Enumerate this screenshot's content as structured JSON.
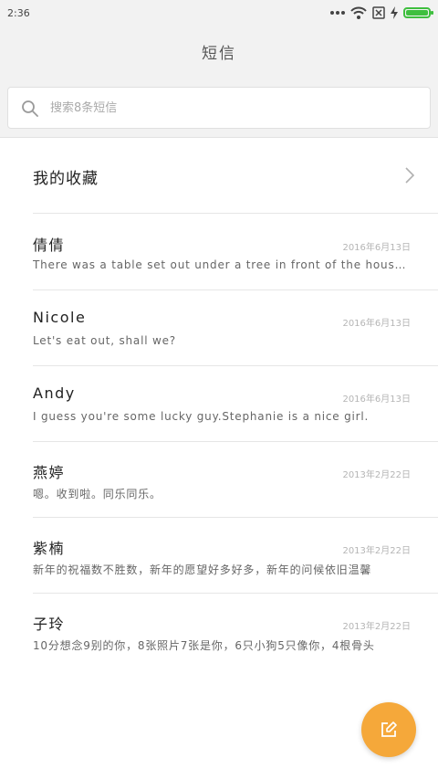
{
  "status_bar": {
    "time": "2:36",
    "icons": [
      "more-dots-icon",
      "wifi-icon",
      "no-sim-icon",
      "charging-icon",
      "battery-icon"
    ],
    "battery_level": 1.0,
    "battery_color": "#3fbf3f"
  },
  "header": {
    "title": "短信"
  },
  "search": {
    "placeholder": "搜索8条短信",
    "value": ""
  },
  "favorites": {
    "label": "我的收藏"
  },
  "conversations": [
    {
      "name": "倩倩",
      "date": "2016年6月13日",
      "snippet": "There was a table set out under a tree in front of the house, and the March Hare and the Hatter were having tea at it"
    },
    {
      "name": "Nicole",
      "date": "2016年6月13日",
      "snippet": "Let's eat out, shall we?"
    },
    {
      "name": "Andy",
      "date": "2016年6月13日",
      "snippet": "I guess you're some lucky guy.Stephanie is a nice girl."
    },
    {
      "name": "燕婷",
      "date": "2013年2月22日",
      "snippet": "嗯。收到啦。同乐同乐。"
    },
    {
      "name": "紫楠",
      "date": "2013年2月22日",
      "snippet": "新年的祝福数不胜数，新年的愿望好多好多，新年的问候依旧温馨"
    },
    {
      "name": "子玲",
      "date": "2013年2月22日",
      "snippet": "10分想念9别的你，8张照片7张是你，6只小狗5只像你，4根骨头"
    }
  ],
  "fab": {
    "icon": "compose-icon",
    "color": "#f5a83a"
  }
}
